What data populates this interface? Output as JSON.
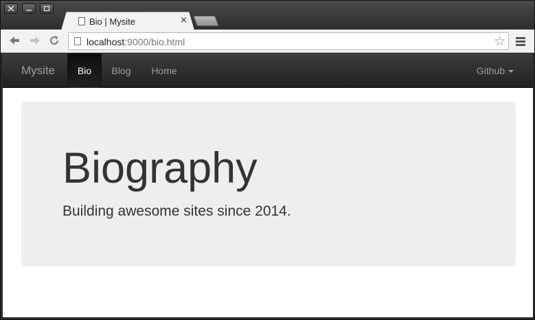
{
  "browser": {
    "tab_title": "Bio | Mysite",
    "tab_close": "×",
    "url_host": "localhost",
    "url_rest": ":9000/bio.html"
  },
  "site": {
    "brand": "Mysite",
    "nav": [
      {
        "label": "Bio",
        "active": true
      },
      {
        "label": "Blog",
        "active": false
      },
      {
        "label": "Home",
        "active": false
      }
    ],
    "right_nav": {
      "label": "Github"
    }
  },
  "jumbotron": {
    "title": "Biography",
    "lead": "Building awesome sites since 2014."
  },
  "colors": {
    "navbar": "#222222",
    "jumbotron_bg": "#eeeeee",
    "text": "#333333"
  }
}
